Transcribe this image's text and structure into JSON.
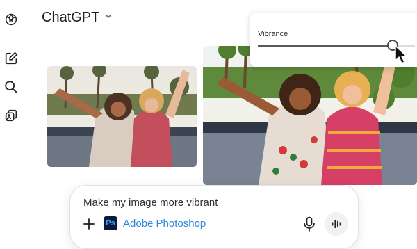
{
  "header": {
    "model_name": "ChatGPT"
  },
  "sidebar": {
    "items": [
      {
        "icon": "openai-logo-icon"
      },
      {
        "icon": "new-chat-icon"
      },
      {
        "icon": "search-icon"
      },
      {
        "icon": "library-icon"
      }
    ]
  },
  "vibrance": {
    "label": "Vibrance",
    "level": 0.86
  },
  "composer": {
    "prompt": "Make my image more vibrant",
    "app_name": "Adobe Photoshop",
    "app_logo_text": "Ps"
  },
  "colors": {
    "accent_link": "#2c86e0",
    "ps_bg": "#0b1a3b",
    "ps_text": "#39a6ff"
  }
}
